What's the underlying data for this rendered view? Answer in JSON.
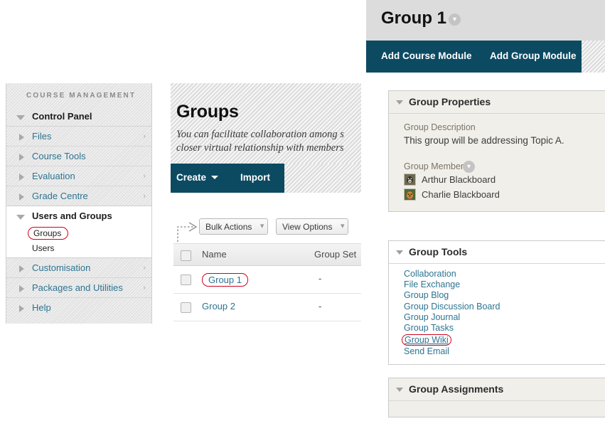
{
  "sidebar": {
    "section_label": "COURSE MANAGEMENT",
    "control_panel": "Control Panel",
    "items": [
      {
        "label": "Files",
        "has_chevron": true
      },
      {
        "label": "Course Tools",
        "has_chevron": false
      },
      {
        "label": "Evaluation",
        "has_chevron": true
      },
      {
        "label": "Grade Centre",
        "has_chevron": true
      }
    ],
    "users_and_groups": "Users and Groups",
    "sub_items": [
      {
        "label": "Groups",
        "highlighted": true
      },
      {
        "label": "Users",
        "highlighted": false
      }
    ],
    "bottom_items": [
      {
        "label": "Customisation",
        "has_chevron": true
      },
      {
        "label": "Packages and Utilities",
        "has_chevron": true
      },
      {
        "label": "Help",
        "has_chevron": false
      }
    ],
    "chevron_glyph": "›"
  },
  "middle": {
    "page_title": "Groups",
    "page_description": "You can facilitate collaboration among s\ncloser virtual relationship with members",
    "action_bar": {
      "create_label": "Create",
      "import_label": "Import"
    },
    "toolbar": {
      "bulk_actions_label": "Bulk Actions",
      "view_options_label": "View Options",
      "double_chevron": "⌄"
    },
    "table": {
      "headers": [
        "Name",
        "Group Set"
      ],
      "rows": [
        {
          "name": "Group 1",
          "group_set": "-",
          "highlighted": true
        },
        {
          "name": "Group 2",
          "group_set": "-",
          "highlighted": false
        }
      ]
    }
  },
  "right": {
    "group_title": "Group 1",
    "title_chevron": "⌄",
    "module_bar": {
      "add_course_module": "Add Course Module",
      "add_group_module": "Add Group Module"
    },
    "group_properties": {
      "heading": "Group Properties",
      "description_label": "Group Description",
      "description_value": "This group will be addressing Topic A.",
      "members_label": "Group Members",
      "members_chevron": "⌄",
      "members": [
        {
          "name": "Arthur Blackboard"
        },
        {
          "name": "Charlie Blackboard"
        }
      ]
    },
    "group_tools": {
      "heading": "Group Tools",
      "links": [
        {
          "label": "Collaboration",
          "highlighted": false
        },
        {
          "label": "File Exchange",
          "highlighted": false
        },
        {
          "label": "Group Blog",
          "highlighted": false
        },
        {
          "label": "Group Discussion Board",
          "highlighted": false
        },
        {
          "label": "Group Journal",
          "highlighted": false
        },
        {
          "label": "Group Tasks",
          "highlighted": false
        },
        {
          "label": "Group Wiki",
          "highlighted": true
        },
        {
          "label": "Send Email",
          "highlighted": false
        }
      ]
    },
    "group_assignments": {
      "heading": "Group Assignments"
    }
  },
  "colors": {
    "nav_teal": "#0c4a62",
    "link_blue": "#2d7491",
    "highlight_red": "#d0021b",
    "panel_cream": "#f1efe9",
    "title_bar_grey": "#dcdcdc"
  }
}
